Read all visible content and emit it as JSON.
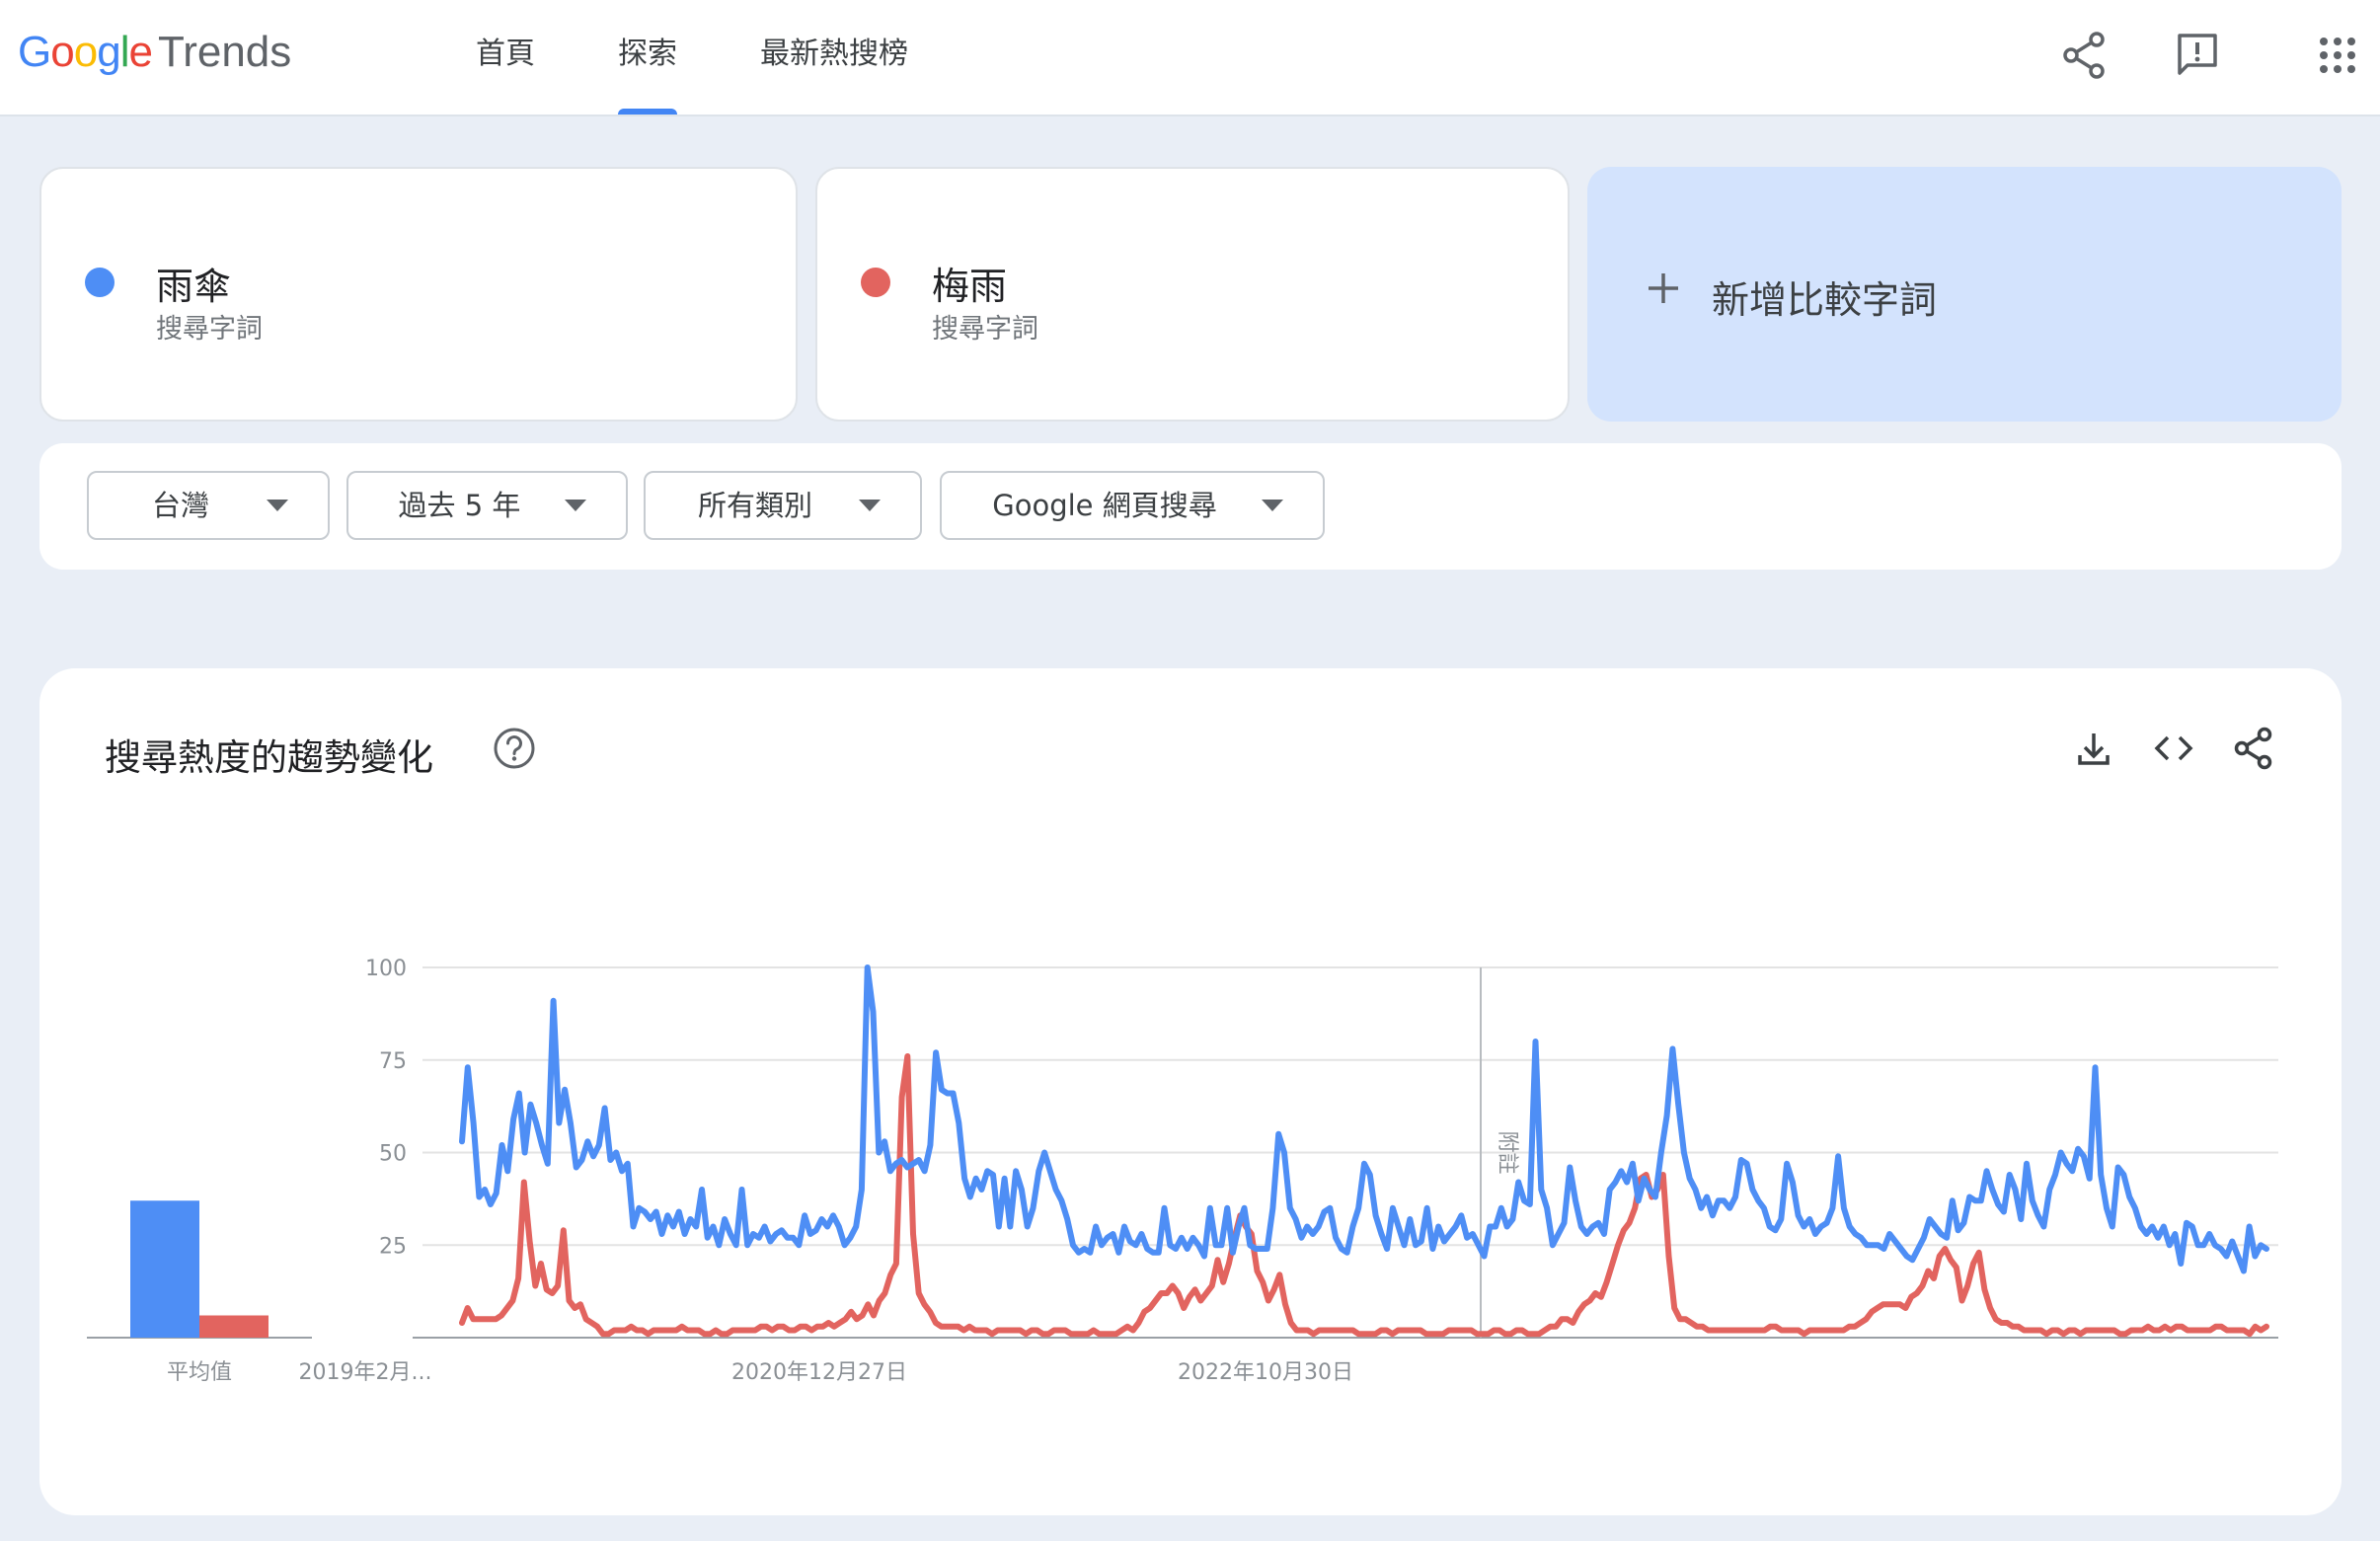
{
  "header": {
    "logo_google": [
      "G",
      "o",
      "o",
      "g",
      "l",
      "e"
    ],
    "logo_trends": "Trends",
    "nav": [
      {
        "label": "首頁",
        "active": false
      },
      {
        "label": "探索",
        "active": true
      },
      {
        "label": "最新熱搜榜",
        "active": false
      }
    ],
    "icons": [
      "share-icon",
      "feedback-icon",
      "apps-grid-icon"
    ]
  },
  "terms": [
    {
      "name": "雨傘",
      "subtitle": "搜尋字詞",
      "color": "#4e8ef5"
    },
    {
      "name": "梅雨",
      "subtitle": "搜尋字詞",
      "color": "#e2645f"
    }
  ],
  "add_term": {
    "label": "新增比較字詞"
  },
  "filters": {
    "region": "台灣",
    "time": "過去 5 年",
    "category": "所有類別",
    "property": "Google 網頁搜尋"
  },
  "chart": {
    "title": "搜尋熱度的趨勢變化",
    "tools": [
      "download-icon",
      "embed-code-icon",
      "share-icon"
    ],
    "note_label": "附註"
  },
  "chart_data": {
    "type": "line",
    "title": "搜尋熱度的趨勢變化",
    "x_tick_labels": [
      "2019年2月...",
      "2020年12月27日",
      "2022年10月30日"
    ],
    "y_ticks": [
      25,
      50,
      75,
      100
    ],
    "ylim": [
      0,
      100
    ],
    "grid": true,
    "average_label": "平均值",
    "averages": [
      {
        "name": "雨傘",
        "value": 37
      },
      {
        "name": "梅雨",
        "value": 6
      }
    ],
    "series": [
      {
        "name": "雨傘",
        "color": "#4e8ef5",
        "values": [
          53,
          73,
          58,
          38,
          40,
          36,
          39,
          52,
          45,
          59,
          66,
          50,
          63,
          58,
          52,
          47,
          91,
          58,
          67,
          58,
          46,
          48,
          53,
          49,
          52,
          62,
          48,
          50,
          45,
          47,
          30,
          35,
          34,
          32,
          34,
          28,
          33,
          30,
          34,
          28,
          32,
          30,
          40,
          27,
          30,
          25,
          32,
          28,
          25,
          40,
          25,
          28,
          27,
          30,
          26,
          28,
          29,
          27,
          27,
          25,
          33,
          28,
          29,
          32,
          30,
          33,
          30,
          25,
          27,
          30,
          40,
          100,
          88,
          50,
          53,
          45,
          47,
          48,
          46,
          47,
          48,
          45,
          52,
          77,
          67,
          66,
          66,
          58,
          43,
          38,
          43,
          40,
          45,
          44,
          30,
          43,
          30,
          45,
          40,
          30,
          35,
          45,
          50,
          45,
          40,
          37,
          32,
          25,
          23,
          24,
          23,
          30,
          25,
          27,
          28,
          23,
          30,
          26,
          25,
          28,
          24,
          23,
          23,
          35,
          25,
          24,
          27,
          24,
          27,
          25,
          22,
          35,
          25,
          25,
          35,
          23,
          30,
          35,
          25,
          24,
          24,
          24,
          35,
          55,
          50,
          35,
          32,
          27,
          30,
          28,
          30,
          34,
          35,
          27,
          24,
          23,
          30,
          35,
          47,
          44,
          33,
          28,
          24,
          35,
          30,
          25,
          32,
          25,
          26,
          35,
          24,
          30,
          26,
          28,
          30,
          33,
          27,
          28,
          25,
          22,
          30,
          30,
          35,
          30,
          32,
          42,
          37,
          36,
          80,
          40,
          35,
          25,
          28,
          31,
          46,
          37,
          30,
          28,
          30,
          31,
          28,
          40,
          42,
          45,
          42,
          47,
          37,
          43,
          40,
          38,
          50,
          60,
          78,
          63,
          50,
          43,
          40,
          35,
          38,
          33,
          37,
          37,
          35,
          38,
          48,
          47,
          40,
          37,
          35,
          30,
          29,
          32,
          47,
          42,
          33,
          30,
          32,
          28,
          30,
          31,
          35,
          49,
          35,
          30,
          28,
          27,
          25,
          25,
          25,
          24,
          28,
          26,
          24,
          22,
          21,
          24,
          27,
          32,
          30,
          28,
          27,
          37,
          29,
          31,
          38,
          37,
          37,
          45,
          40,
          36,
          34,
          44,
          40,
          32,
          47,
          37,
          33,
          30,
          40,
          44,
          50,
          47,
          45,
          51,
          49,
          43,
          73,
          44,
          35,
          30,
          46,
          44,
          38,
          35,
          30,
          28,
          30,
          27,
          30,
          25,
          28,
          20,
          31,
          30,
          25,
          25,
          28,
          25,
          24,
          22,
          26,
          22,
          18,
          30,
          22,
          25,
          24
        ]
      },
      {
        "name": "梅雨",
        "color": "#e2645f",
        "values": [
          4,
          8,
          5,
          5,
          5,
          5,
          5,
          6,
          8,
          10,
          16,
          42,
          26,
          14,
          20,
          13,
          12,
          14,
          29,
          10,
          8,
          9,
          5,
          4,
          3,
          1,
          1,
          2,
          2,
          2,
          3,
          2,
          2,
          1,
          2,
          2,
          2,
          2,
          2,
          3,
          2,
          2,
          2,
          1,
          1,
          2,
          1,
          1,
          2,
          2,
          2,
          2,
          2,
          3,
          3,
          2,
          3,
          3,
          2,
          2,
          3,
          3,
          2,
          3,
          3,
          4,
          3,
          4,
          5,
          7,
          5,
          6,
          9,
          6,
          10,
          12,
          17,
          20,
          65,
          76,
          28,
          12,
          9,
          7,
          4,
          3,
          3,
          3,
          3,
          2,
          3,
          2,
          2,
          2,
          1,
          2,
          2,
          2,
          2,
          2,
          1,
          2,
          2,
          1,
          1,
          2,
          2,
          2,
          1,
          1,
          1,
          1,
          2,
          1,
          1,
          1,
          1,
          2,
          3,
          2,
          4,
          7,
          8,
          10,
          12,
          12,
          14,
          12,
          8,
          11,
          13,
          10,
          12,
          14,
          21,
          15,
          20,
          27,
          33,
          30,
          28,
          18,
          15,
          10,
          13,
          17,
          9,
          4,
          2,
          2,
          2,
          1,
          2,
          2,
          2,
          2,
          2,
          2,
          2,
          1,
          1,
          1,
          1,
          2,
          2,
          1,
          2,
          2,
          2,
          2,
          2,
          1,
          1,
          1,
          1,
          2,
          2,
          2,
          2,
          2,
          1,
          1,
          1,
          2,
          2,
          1,
          1,
          2,
          2,
          1,
          1,
          1,
          2,
          3,
          3,
          5,
          5,
          4,
          7,
          9,
          10,
          12,
          11,
          15,
          20,
          25,
          29,
          31,
          35,
          43,
          44,
          38,
          40,
          44,
          22,
          8,
          5,
          5,
          4,
          3,
          3,
          2,
          2,
          2,
          2,
          2,
          2,
          2,
          2,
          2,
          2,
          2,
          3,
          3,
          2,
          2,
          2,
          2,
          1,
          2,
          2,
          2,
          2,
          2,
          2,
          2,
          3,
          3,
          4,
          5,
          7,
          8,
          9,
          9,
          9,
          9,
          8,
          11,
          12,
          14,
          18,
          16,
          22,
          24,
          21,
          19,
          10,
          14,
          20,
          23,
          13,
          8,
          5,
          4,
          4,
          3,
          3,
          2,
          2,
          2,
          2,
          1,
          2,
          2,
          1,
          2,
          2,
          1,
          2,
          2,
          2,
          2,
          2,
          2,
          1,
          1,
          2,
          2,
          2,
          3,
          2,
          2,
          3,
          2,
          3,
          3,
          2,
          2,
          2,
          2,
          2,
          3,
          3,
          2,
          2,
          2,
          2,
          1,
          3,
          2,
          3
        ]
      }
    ]
  }
}
